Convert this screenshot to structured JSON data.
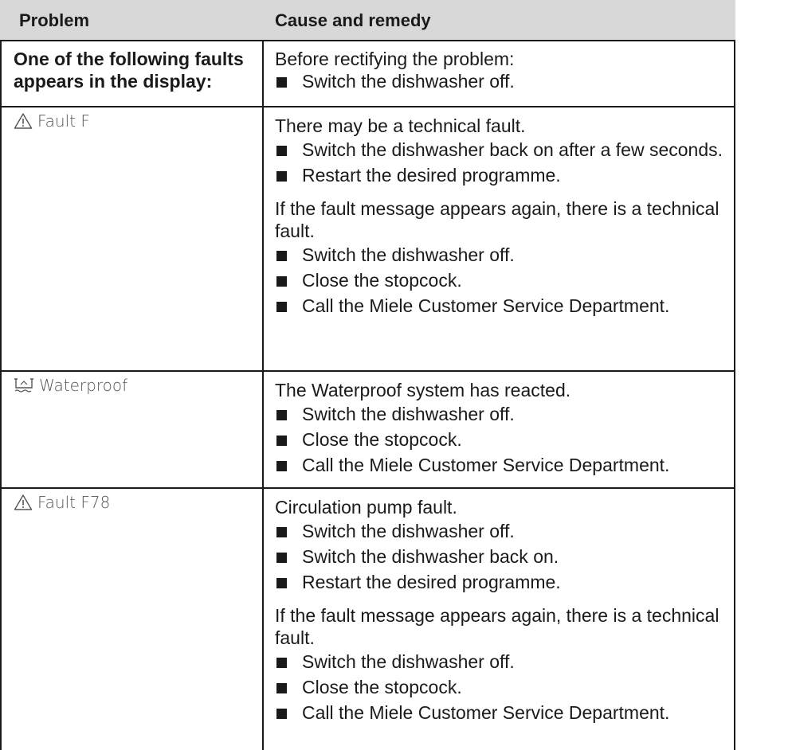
{
  "headers": {
    "problem": "Problem",
    "remedy": "Cause and remedy"
  },
  "rows": [
    {
      "problem": "One of the following faults appears in the display:",
      "intro": "Before rectifying the problem:",
      "steps": [
        "Switch the dishwasher off."
      ]
    },
    {
      "code": "Fault F",
      "icon": "warning-triangle-icon",
      "intro": "There may be a technical fault.",
      "steps": [
        "Switch the dishwasher back on after a few seconds.",
        "Restart the desired programme."
      ],
      "note": "If the fault message appears again, there is a technical fault.",
      "steps2": [
        "Switch the dishwasher off.",
        "Close the stopcock.",
        "Call the Miele Customer Service Department."
      ]
    },
    {
      "code": "Waterproof",
      "icon": "waterproof-icon",
      "intro": "The Waterproof system has reacted.",
      "steps": [
        "Switch the dishwasher off.",
        "Close the stopcock.",
        "Call the Miele Customer Service Department."
      ]
    },
    {
      "code": "Fault F78",
      "icon": "warning-triangle-icon",
      "intro": "Circulation pump fault.",
      "steps": [
        "Switch the dishwasher off.",
        "Switch the dishwasher back on.",
        "Restart the desired programme."
      ],
      "note": "If the fault message appears again, there is a technical fault.",
      "steps2": [
        "Switch the dishwasher off.",
        "Close the stopcock.",
        "Call the Miele Customer Service Department."
      ]
    }
  ]
}
